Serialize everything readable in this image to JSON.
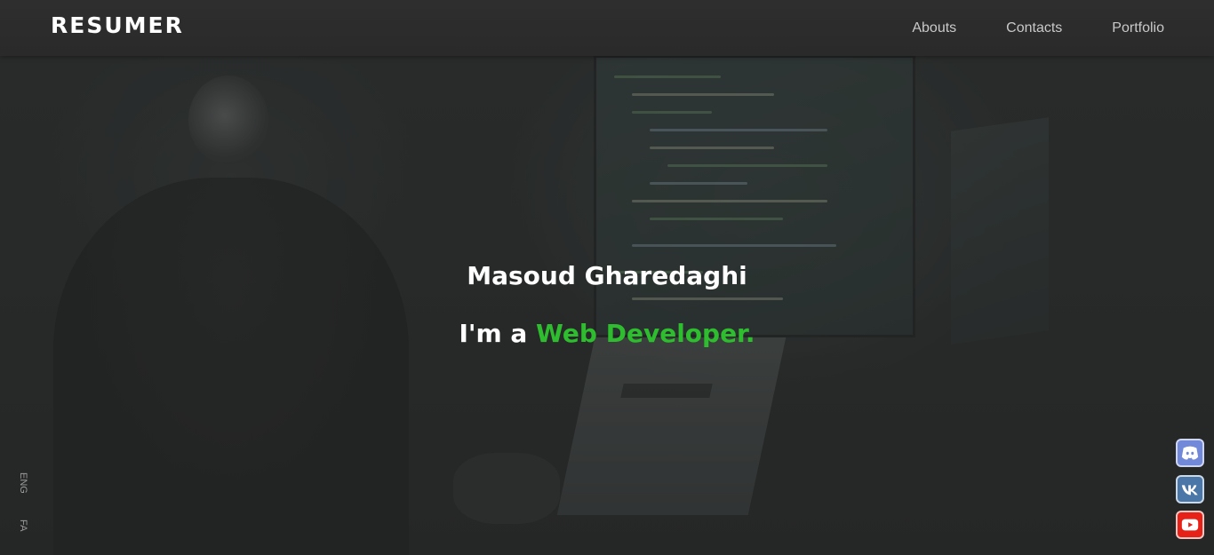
{
  "header": {
    "logo": "RESUMER",
    "nav": [
      {
        "label": "Abouts"
      },
      {
        "label": "Contacts"
      },
      {
        "label": "Portfolio"
      }
    ]
  },
  "hero": {
    "name": "Masoud Gharedaghi",
    "role_prefix": "I'm a ",
    "role_highlight": "Web Developer."
  },
  "languages": [
    "ENG",
    "FA"
  ],
  "social": [
    {
      "name": "discord",
      "icon": "discord-icon",
      "color": "#7289da"
    },
    {
      "name": "vk",
      "icon": "vk-icon",
      "color": "#4a76a8"
    },
    {
      "name": "youtube",
      "icon": "youtube-icon",
      "color": "#e62117"
    }
  ],
  "colors": {
    "accent": "#2ebd2e",
    "header_bg": "#2c2c2c",
    "nav_text": "#c9c9c9"
  }
}
